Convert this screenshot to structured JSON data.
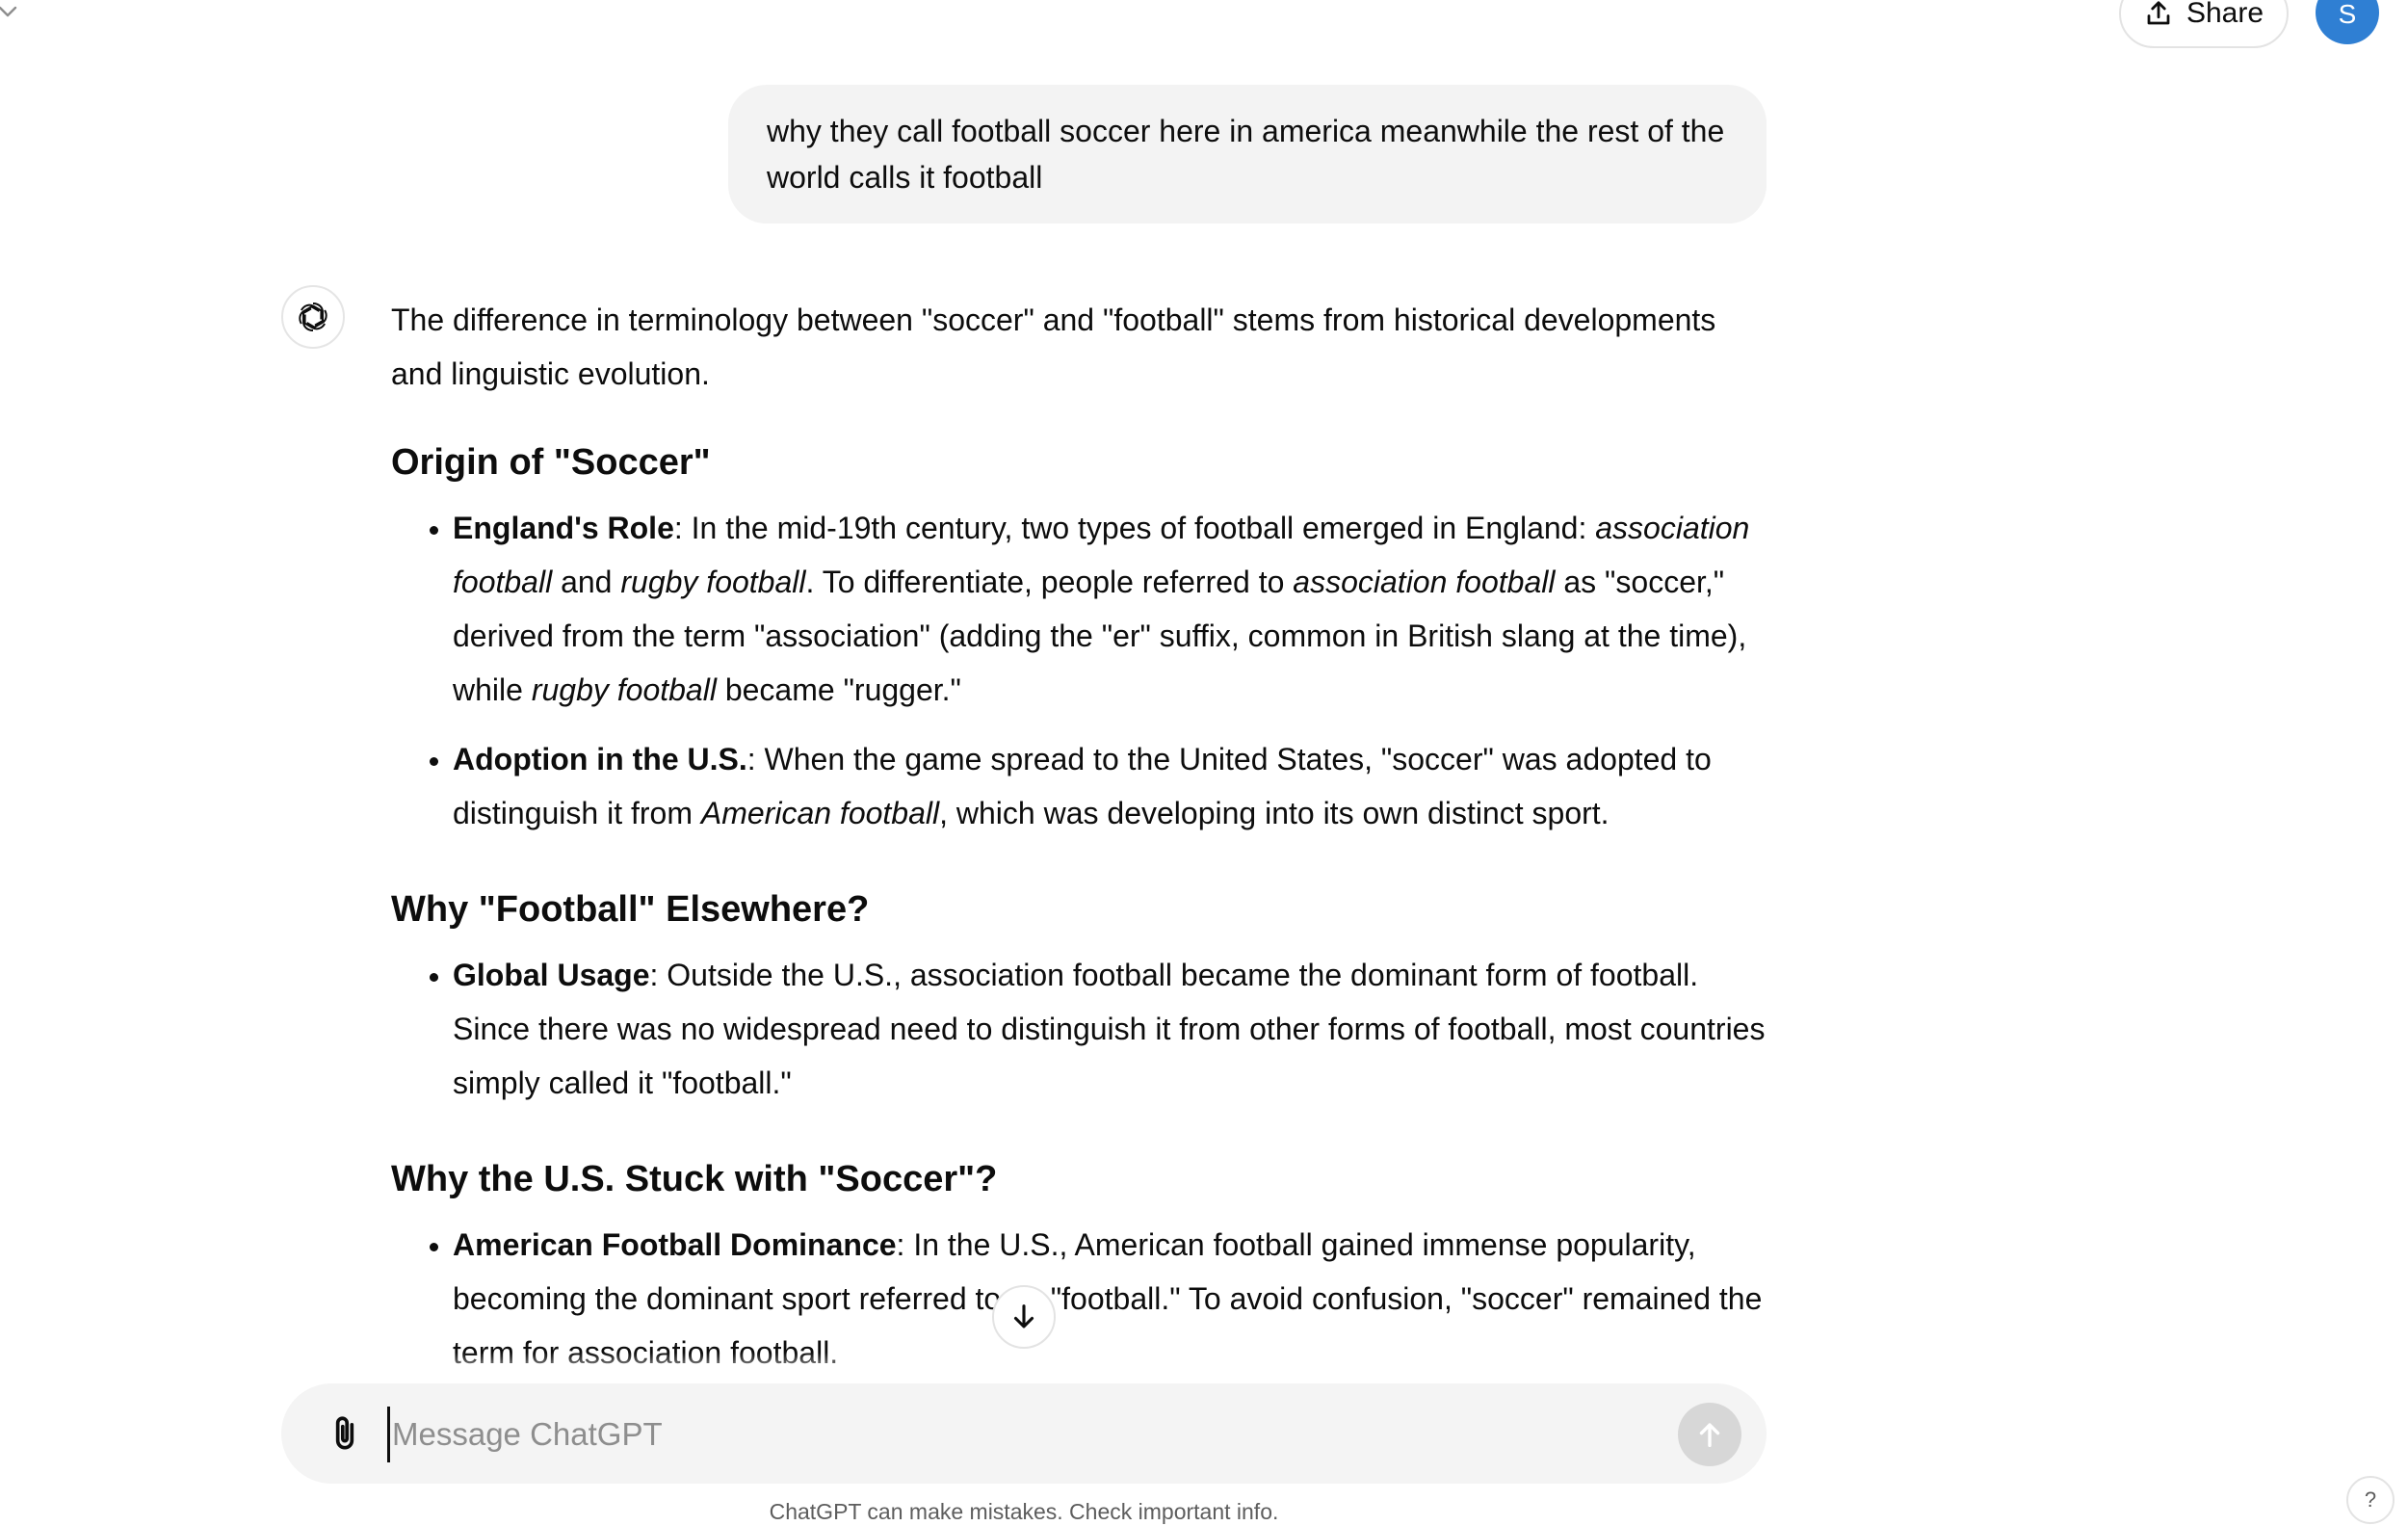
{
  "header": {
    "share_label": "Share",
    "avatar_initial": "S"
  },
  "user_message": "why they call football soccer here in america meanwhile the rest of the world calls it football",
  "answer": {
    "intro": "The difference in terminology between \"soccer\" and \"football\" stems from historical developments and linguistic evolution.",
    "sections": [
      {
        "heading": "Origin of \"Soccer\"",
        "items": [
          {
            "term": "England's Role",
            "segments": [
              ": In the mid-19th century, two types of football emerged in England: ",
              "association football",
              " and ",
              "rugby football",
              ". To differentiate, people referred to ",
              "association football",
              " as \"soccer,\" derived from the term \"association\" (adding the \"er\" suffix, common in British slang at the time), while ",
              "rugby football",
              " became \"rugger.\""
            ]
          },
          {
            "term": "Adoption in the U.S.",
            "segments": [
              ": When the game spread to the United States, \"soccer\" was adopted to distinguish it from ",
              "American football",
              ", which was developing into its own distinct sport."
            ]
          }
        ]
      },
      {
        "heading": "Why \"Football\" Elsewhere?",
        "items": [
          {
            "term": "Global Usage",
            "text": ": Outside the U.S., association football became the dominant form of football. Since there was no widespread need to distinguish it from other forms of football, most countries simply called it \"football.\""
          }
        ]
      },
      {
        "heading": "Why the U.S. Stuck with \"Soccer\"?",
        "items": [
          {
            "term": "American Football Dominance",
            "text": ": In the U.S., American football gained immense popularity, becoming the dominant sport referred to as \"football.\" To avoid confusion, \"soccer\" remained the term for association football."
          }
        ]
      }
    ]
  },
  "composer": {
    "placeholder": "Message ChatGPT"
  },
  "footer": {
    "disclaimer": "ChatGPT can make mistakes. Check important info.",
    "help_label": "?"
  },
  "icons": {
    "chevron": "chevron-down-icon",
    "share": "share-icon",
    "assistant": "chatgpt-logo-icon",
    "scroll": "arrow-down-icon",
    "attach": "paperclip-icon",
    "send": "arrow-up-icon"
  }
}
